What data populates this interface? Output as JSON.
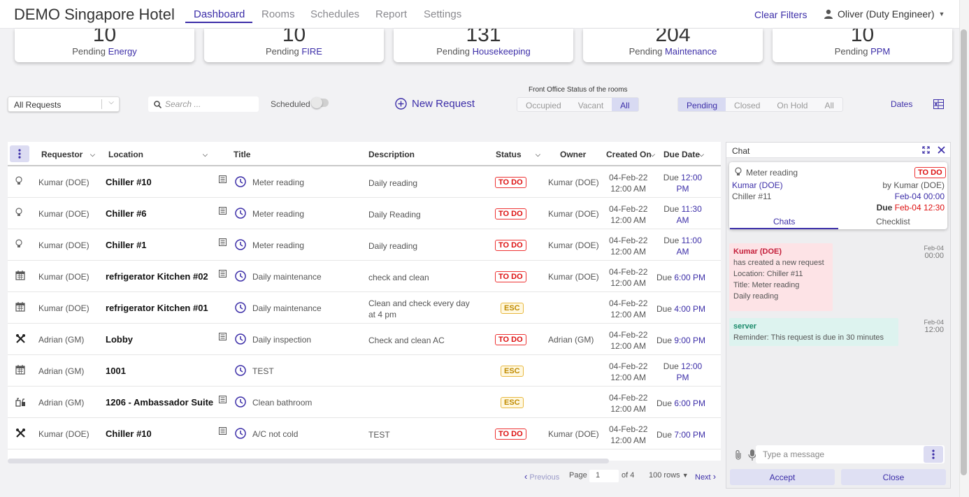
{
  "app": {
    "hotel_name": "DEMO Singapore Hotel"
  },
  "nav": {
    "tabs": [
      "Dashboard",
      "Rooms",
      "Schedules",
      "Report",
      "Settings"
    ],
    "active_tab": "Dashboard",
    "clear_filters": "Clear Filters",
    "user": "Oliver (Duty Engineer)"
  },
  "summary_cards": [
    {
      "count": "10",
      "prefix": "Pending",
      "category": "Energy"
    },
    {
      "count": "10",
      "prefix": "Pending",
      "category": "FIRE"
    },
    {
      "count": "131",
      "prefix": "Pending",
      "category": "Housekeeping"
    },
    {
      "count": "204",
      "prefix": "Pending",
      "category": "Maintenance"
    },
    {
      "count": "10",
      "prefix": "Pending",
      "category": "PPM"
    }
  ],
  "filters": {
    "request_type": "All Requests",
    "search_placeholder": "Search ...",
    "scheduled_label": "Scheduled",
    "scheduled_on": false,
    "new_request": "New Request",
    "front_office_label": "Front Office Status of the rooms",
    "room_status_options": [
      "Occupied",
      "Vacant",
      "All"
    ],
    "room_status_selected": "All",
    "request_status_options": [
      "Pending",
      "Closed",
      "On Hold",
      "All"
    ],
    "request_status_selected": "Pending",
    "dates": "Dates"
  },
  "table": {
    "columns": [
      "Requestor",
      "Location",
      "Title",
      "Description",
      "Status",
      "Owner",
      "Created On",
      "Due Date"
    ],
    "rows": [
      {
        "icon": "bulb-icon",
        "requestor": "Kumar (DOE)",
        "location": "Chiller #10",
        "has_notes": true,
        "title": "Meter reading",
        "description": "Daily reading",
        "status": "TO DO",
        "owner": "Kumar (DOE)",
        "created_date": "04-Feb-22",
        "created_time": "12:00 AM",
        "due_prefix": "Due",
        "due_time": "12:00 PM"
      },
      {
        "icon": "bulb-icon",
        "requestor": "Kumar (DOE)",
        "location": "Chiller #6",
        "has_notes": true,
        "title": "Meter reading",
        "description": "Daily Reading",
        "status": "TO DO",
        "owner": "Kumar (DOE)",
        "created_date": "04-Feb-22",
        "created_time": "12:00 AM",
        "due_prefix": "Due",
        "due_time": "11:30 AM"
      },
      {
        "icon": "bulb-icon",
        "requestor": "Kumar (DOE)",
        "location": "Chiller #1",
        "has_notes": true,
        "title": "Meter reading",
        "description": "Daily reading",
        "status": "TO DO",
        "owner": "Kumar (DOE)",
        "created_date": "04-Feb-22",
        "created_time": "12:00 AM",
        "due_prefix": "Due",
        "due_time": "11:00 AM"
      },
      {
        "icon": "calendar-icon",
        "requestor": "Kumar (DOE)",
        "location": "refrigerator Kitchen #02",
        "has_notes": true,
        "title": "Daily maintenance",
        "description": "check and clean",
        "status": "TO DO",
        "owner": "Kumar (DOE)",
        "created_date": "04-Feb-22",
        "created_time": "12:00 AM",
        "due_prefix": "Due",
        "due_time": "6:00 PM"
      },
      {
        "icon": "calendar-icon",
        "requestor": "Kumar (DOE)",
        "location": "refrigerator Kitchen #01",
        "has_notes": false,
        "title": "Daily maintenance",
        "description": "Clean and check every day at 4 pm",
        "status": "ESC",
        "owner": "",
        "created_date": "04-Feb-22",
        "created_time": "12:00 AM",
        "due_prefix": "Due",
        "due_time": "4:00 PM"
      },
      {
        "icon": "tools-icon",
        "requestor": "Adrian (GM)",
        "location": "Lobby",
        "has_notes": true,
        "title": "Daily inspection",
        "description": "Check and clean AC",
        "status": "TO DO",
        "owner": "Adrian (GM)",
        "created_date": "04-Feb-22",
        "created_time": "12:00 AM",
        "due_prefix": "Due",
        "due_time": "9:00 PM"
      },
      {
        "icon": "calendar-icon",
        "requestor": "Adrian (GM)",
        "location": "1001",
        "has_notes": false,
        "title": "TEST",
        "description": "",
        "status": "ESC",
        "owner": "",
        "created_date": "04-Feb-22",
        "created_time": "12:00 AM",
        "due_prefix": "Due",
        "due_time": "12:00 PM"
      },
      {
        "icon": "cleaning-icon",
        "requestor": "Adrian (GM)",
        "location": "1206 - Ambassador Suite",
        "has_notes": true,
        "title": "Clean bathroom",
        "description": "",
        "status": "ESC",
        "owner": "",
        "created_date": "04-Feb-22",
        "created_time": "12:00 AM",
        "due_prefix": "Due",
        "due_time": "6:00 PM"
      },
      {
        "icon": "tools-icon",
        "requestor": "Kumar (DOE)",
        "location": "Chiller #10",
        "has_notes": true,
        "title": "A/C not cold",
        "description": "TEST",
        "status": "TO DO",
        "owner": "Kumar (DOE)",
        "created_date": "04-Feb-22",
        "created_time": "12:00 AM",
        "due_prefix": "Due",
        "due_time": "7:00 PM"
      }
    ]
  },
  "pagination": {
    "previous": "Previous",
    "page_label": "Page",
    "page": "1",
    "of_label": "of 4",
    "rows": "100 rows",
    "next": "Next"
  },
  "chat": {
    "title": "Chat",
    "request": {
      "title": "Meter reading",
      "status": "TO DO",
      "requestor": "Kumar (DOE)",
      "by": "by Kumar (DOE)",
      "location": "Chiller #11",
      "created": "Feb-04 00:00",
      "due_label": "Due",
      "due": "Feb-04 12:30"
    },
    "tabs": [
      "Chats",
      "Checklist"
    ],
    "active_tab": "Chats",
    "messages": [
      {
        "sender": "Kumar (DOE)",
        "lines": [
          "has created a new request",
          "Location: Chiller #11",
          "Title: Meter reading",
          "Daily reading"
        ],
        "date": "Feb-04",
        "time": "00:00"
      },
      {
        "sender": "server",
        "lines": [
          "Reminder: This request is due in 30 minutes"
        ],
        "date": "Feb-04",
        "time": "12:00"
      }
    ],
    "input_placeholder": "Type a message",
    "accept": "Accept",
    "close": "Close"
  },
  "colors": {
    "accent": "#3c2ea8",
    "todo": "#dd1111",
    "esc": "#c08a00"
  }
}
